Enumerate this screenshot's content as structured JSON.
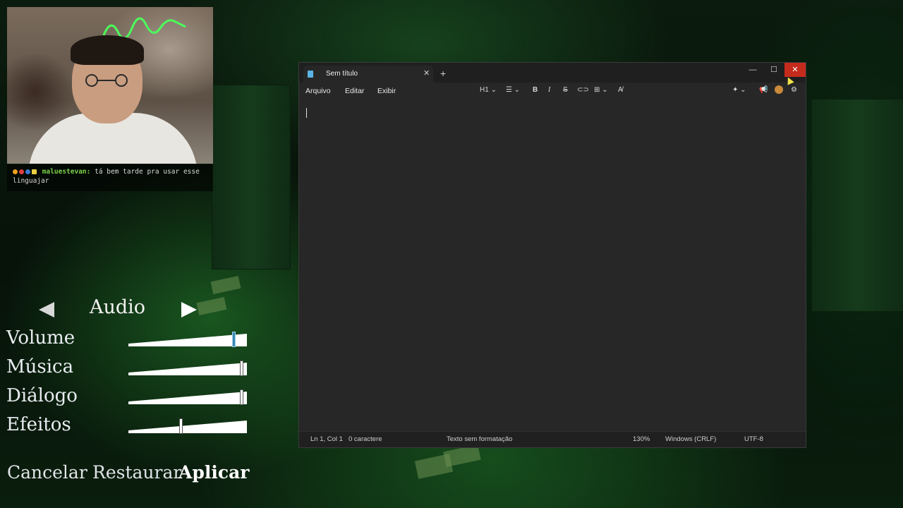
{
  "webcam": {
    "chat": {
      "username": "maluestevan:",
      "message": "tá bem tarde pra usar esse linguajar"
    }
  },
  "game_settings": {
    "section_title": "Audio",
    "settings": [
      {
        "label": "Volume",
        "value": 0.9
      },
      {
        "label": "Música",
        "value": 0.97
      },
      {
        "label": "Diálogo",
        "value": 0.97
      },
      {
        "label": "Efeitos",
        "value": 0.44
      }
    ],
    "buttons": {
      "cancel": "Cancelar",
      "restore": "Restaurar",
      "apply": "Aplicar"
    }
  },
  "notepad": {
    "tab_title": "Sem título",
    "menu": [
      "Arquivo",
      "Editar",
      "Exibir"
    ],
    "toolbar": {
      "heading": "H1"
    },
    "status": {
      "position": "Ln 1, Col 1",
      "chars": "0 caractere",
      "format": "Texto sem formatação",
      "zoom": "130%",
      "line_ending": "Windows (CRLF)",
      "encoding": "UTF-8"
    }
  },
  "colors": {
    "close_button": "#c42b1c",
    "slider_active_knob": "#3a8ab0",
    "chat_username": "#7bd04c"
  }
}
